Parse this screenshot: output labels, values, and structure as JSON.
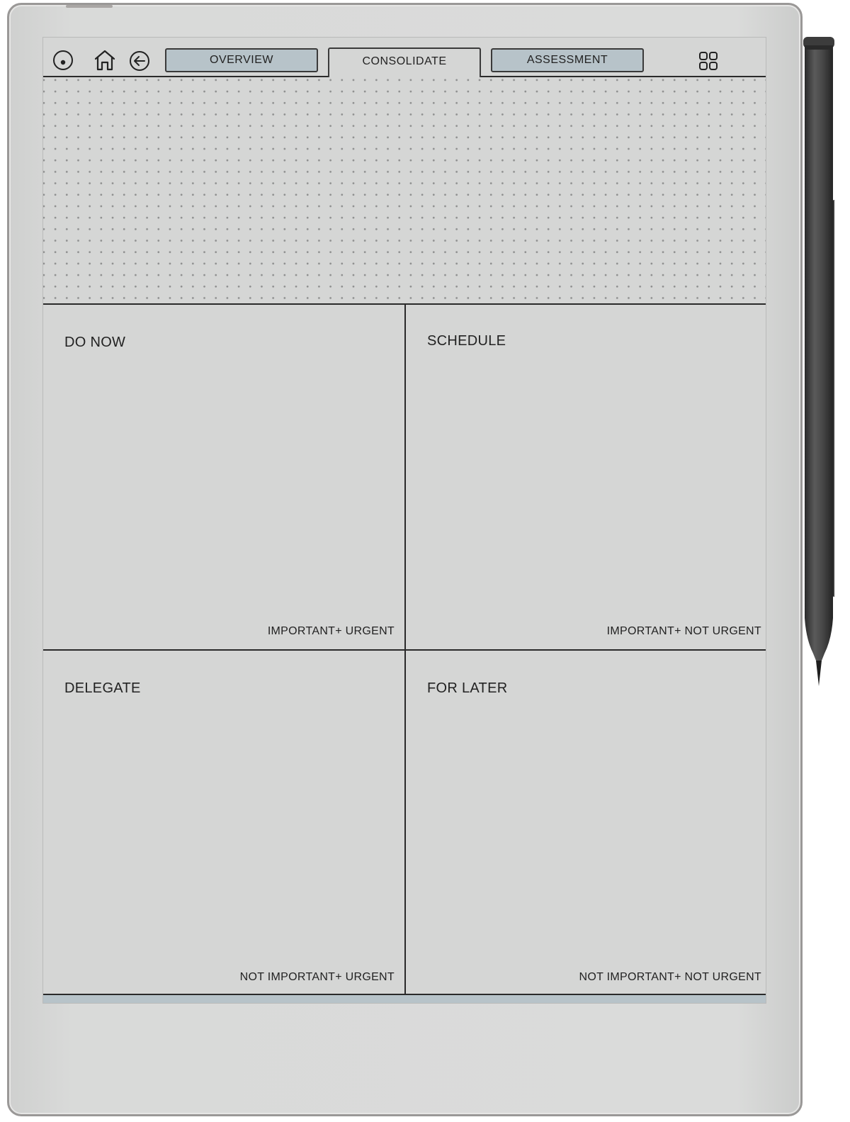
{
  "nav": {
    "icons": [
      "menu-circle-icon",
      "home-icon",
      "back-arrow-icon",
      "grid-icon"
    ],
    "tabs": [
      {
        "label": "OVERVIEW",
        "active": false
      },
      {
        "label": "CONSOLIDATE",
        "active": true
      },
      {
        "label": "ASSESSMENT",
        "active": false
      }
    ]
  },
  "matrix": {
    "quadrants": [
      {
        "title": "DO NOW",
        "subtitle": "IMPORTANT+ URGENT"
      },
      {
        "title": "SCHEDULE",
        "subtitle": "IMPORTANT+ NOT URGENT"
      },
      {
        "title": "DELEGATE",
        "subtitle": "NOT IMPORTANT+ URGENT"
      },
      {
        "title": "FOR LATER",
        "subtitle": "NOT IMPORTANT+ NOT URGENT"
      }
    ]
  },
  "colors": {
    "tab_inactive": "#b7c3c9",
    "screen_bg": "#d5d6d5",
    "line": "#2a2a2a",
    "device_frame": "#dadbda"
  }
}
